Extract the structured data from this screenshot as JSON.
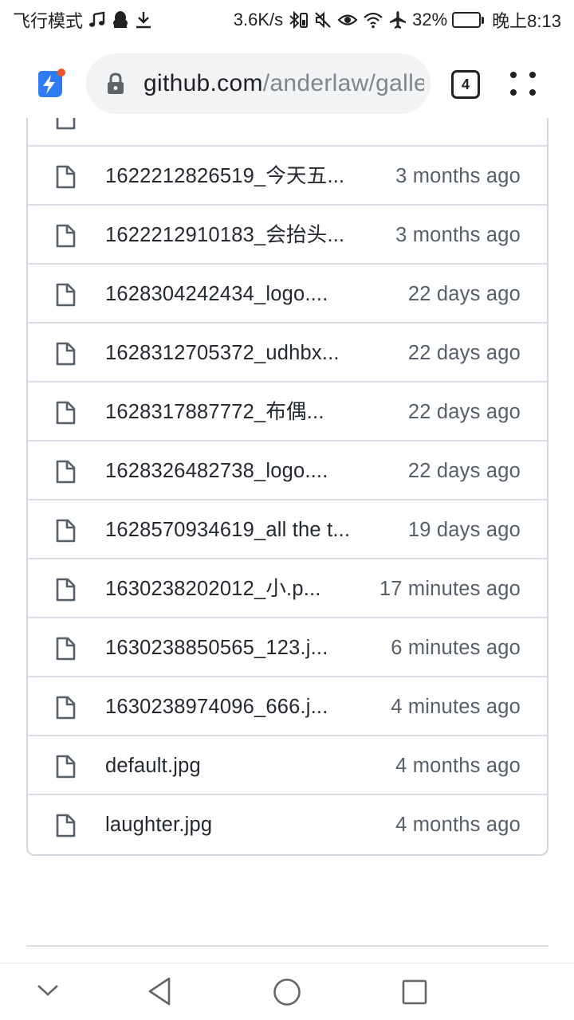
{
  "status_bar": {
    "mode_text": "飞行模式",
    "net_speed": "3.6K/s",
    "battery_percent": "32%",
    "battery_level": 0.32,
    "time": "晚上8:13",
    "left_icons": [
      "music-note-icon",
      "qq-penguin-icon",
      "download-icon"
    ],
    "right_icons": [
      "bluetooth-battery-icon",
      "mute-icon",
      "eye-icon",
      "wifi-icon",
      "airplane-icon",
      "battery-icon"
    ]
  },
  "browser": {
    "url_host": "github.com",
    "url_path": "/anderlaw/gallery",
    "tab_count": "4"
  },
  "files": [
    {
      "name": "",
      "age": ""
    },
    {
      "name": "1622212826519_今天五...",
      "age": "3 months ago"
    },
    {
      "name": "1622212910183_会抬头...",
      "age": "3 months ago"
    },
    {
      "name": "1628304242434_logo....",
      "age": "22 days ago"
    },
    {
      "name": "1628312705372_udhbx...",
      "age": "22 days ago"
    },
    {
      "name": "1628317887772_布偶...",
      "age": "22 days ago"
    },
    {
      "name": "1628326482738_logo....",
      "age": "22 days ago"
    },
    {
      "name": "1628570934619_all the t...",
      "age": "19 days ago"
    },
    {
      "name": "1630238202012_小.p...",
      "age": "17 minutes ago"
    },
    {
      "name": "1630238850565_123.j...",
      "age": "6 minutes ago"
    },
    {
      "name": "1630238974096_666.j...",
      "age": "4 minutes ago"
    },
    {
      "name": "default.jpg",
      "age": "4 months ago"
    },
    {
      "name": "laughter.jpg",
      "age": "4 months ago"
    }
  ],
  "colors": {
    "accent_blue": "#2f7bf5",
    "notification_dot": "#f0552a",
    "border": "#d0d7de"
  }
}
